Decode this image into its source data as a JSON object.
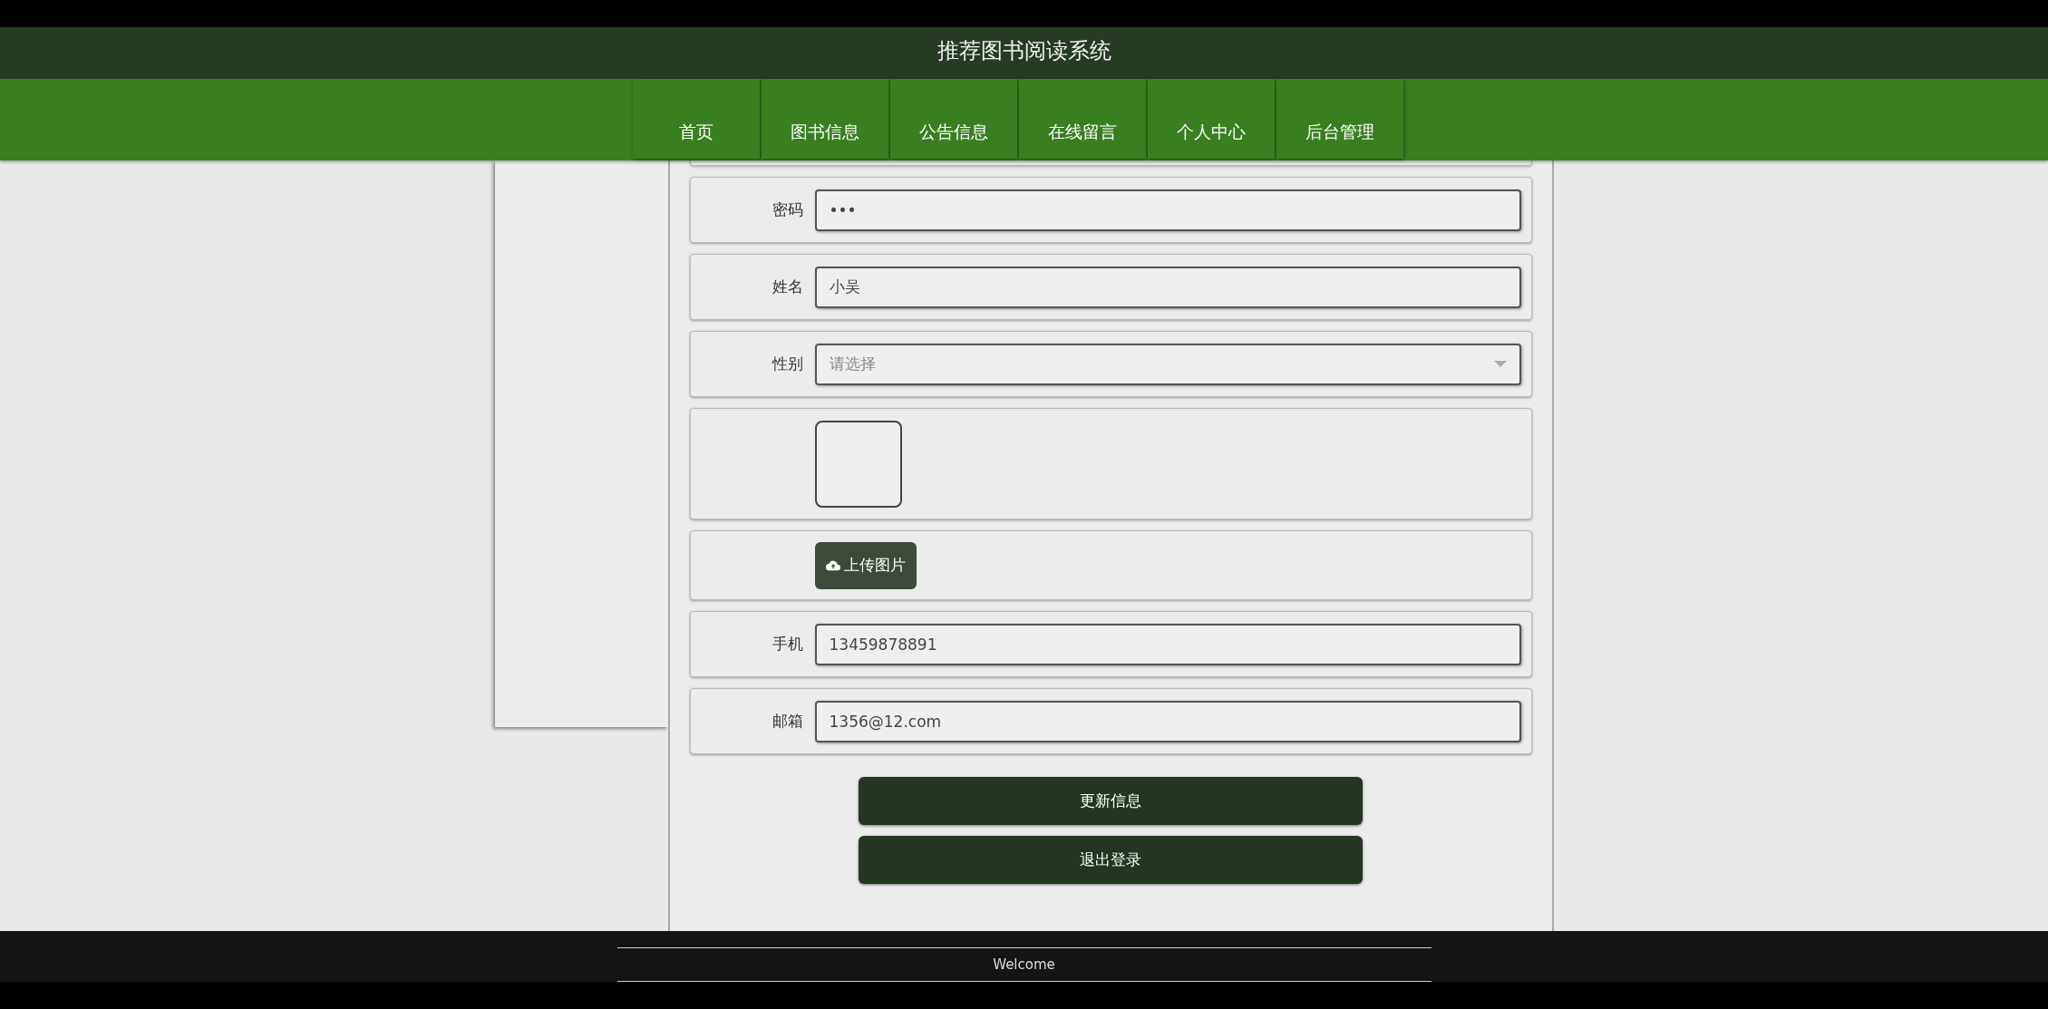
{
  "header": {
    "title": "推荐图书阅读系统"
  },
  "nav": [
    {
      "label": "首页"
    },
    {
      "label": "图书信息"
    },
    {
      "label": "公告信息"
    },
    {
      "label": "在线留言"
    },
    {
      "label": "个人中心"
    },
    {
      "label": "后台管理"
    }
  ],
  "form": {
    "fields": [
      {
        "kind": "input",
        "label": "密码",
        "value": "•••"
      },
      {
        "kind": "input",
        "label": "姓名",
        "value": "小吴"
      },
      {
        "kind": "select",
        "label": "性别",
        "placeholder": "请选择"
      },
      {
        "kind": "image"
      },
      {
        "kind": "upload",
        "button": "上传图片"
      },
      {
        "kind": "input",
        "label": "手机",
        "value": "13459878891"
      },
      {
        "kind": "input",
        "label": "邮箱",
        "value": "1356@12.com"
      }
    ],
    "buttons": [
      "更新信息",
      "退出登录"
    ]
  },
  "footer": {
    "text": "Welcome"
  }
}
